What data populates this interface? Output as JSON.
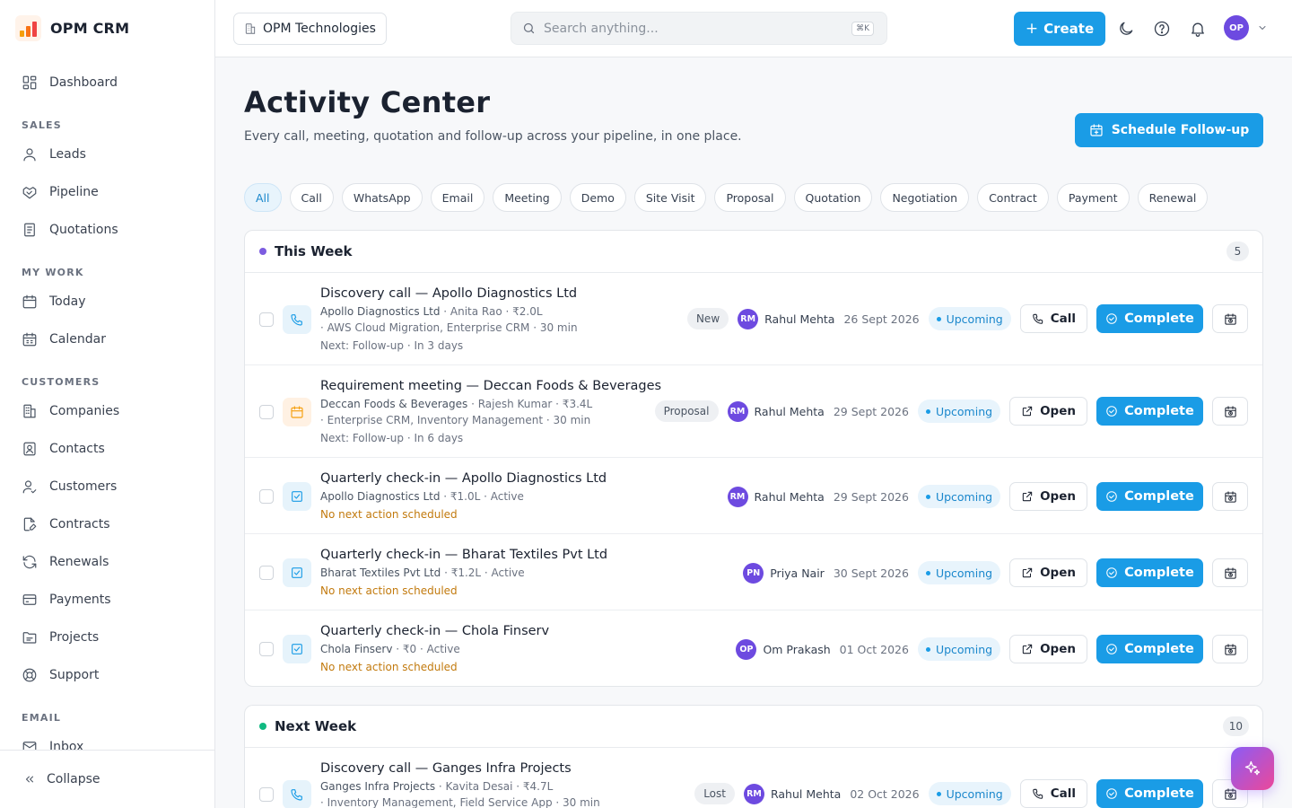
{
  "app": {
    "name": "OPM CRM",
    "logo_colors": [
      "#f59e0b",
      "#f97316",
      "#ef4444"
    ]
  },
  "sidebar": {
    "top": [
      {
        "label": "Dashboard",
        "icon": "dashboard-icon"
      }
    ],
    "sections": [
      {
        "title": "SALES",
        "items": [
          {
            "label": "Leads",
            "icon": "user-icon"
          },
          {
            "label": "Pipeline",
            "icon": "handshake-icon"
          },
          {
            "label": "Quotations",
            "icon": "document-icon"
          }
        ]
      },
      {
        "title": "MY WORK",
        "items": [
          {
            "label": "Today",
            "icon": "calendar-icon"
          },
          {
            "label": "Calendar",
            "icon": "calendar-grid-icon"
          }
        ]
      },
      {
        "title": "CUSTOMERS",
        "items": [
          {
            "label": "Companies",
            "icon": "building-icon"
          },
          {
            "label": "Contacts",
            "icon": "contact-card-icon"
          },
          {
            "label": "Customers",
            "icon": "user-check-icon"
          },
          {
            "label": "Contracts",
            "icon": "file-pen-icon"
          },
          {
            "label": "Renewals",
            "icon": "refresh-icon"
          },
          {
            "label": "Payments",
            "icon": "credit-card-icon"
          },
          {
            "label": "Projects",
            "icon": "folder-icon"
          },
          {
            "label": "Support",
            "icon": "lifebuoy-icon"
          }
        ]
      },
      {
        "title": "EMAIL",
        "items": [
          {
            "label": "Inbox",
            "icon": "mail-icon"
          }
        ]
      }
    ],
    "collapse_label": "Collapse"
  },
  "header": {
    "org": "OPM Technologies",
    "search_placeholder": "Search anything...",
    "search_shortcut": "⌘K",
    "create_label": "Create",
    "avatar": "OP"
  },
  "page": {
    "title": "Activity Center",
    "subtitle": "Every call, meeting, quotation and follow-up across your pipeline, in one place.",
    "schedule_label": "Schedule Follow-up"
  },
  "filters": [
    "All",
    "Call",
    "WhatsApp",
    "Email",
    "Meeting",
    "Demo",
    "Site Visit",
    "Proposal",
    "Quotation",
    "Negotiation",
    "Contract",
    "Payment",
    "Renewal"
  ],
  "active_filter": "All",
  "groups": [
    {
      "title": "This Week",
      "count": "5",
      "dot_color": "#7c5ce0",
      "rows": [
        {
          "type": "call",
          "title": "Discovery call — Apollo Diagnostics Ltd",
          "meta1": "Apollo Diagnostics Ltd",
          "meta1_rest": " · Anita Rao  · ₹2.0L",
          "meta2": " · AWS Cloud Migration, Enterprise CRM  · 30 min",
          "meta3": "Next: Follow-up · In 3 days",
          "stage": "New",
          "owner_initials": "RM",
          "owner": "Rahul Mehta",
          "date": "26 Sept 2026",
          "status": "Upcoming",
          "action": "Call",
          "complete": "Complete"
        },
        {
          "type": "meeting",
          "title": "Requirement meeting — Deccan Foods & Beverages",
          "meta1": "Deccan Foods & Beverages",
          "meta1_rest": " · Rajesh Kumar  · ₹3.4L",
          "meta2": " · Enterprise CRM, Inventory Management  · 30 min",
          "meta3": "Next: Follow-up · In 6 days",
          "stage": "Proposal",
          "owner_initials": "RM",
          "owner": "Rahul Mehta",
          "date": "29 Sept 2026",
          "status": "Upcoming",
          "action": "Open",
          "complete": "Complete"
        },
        {
          "type": "task",
          "title": "Quarterly check-in — Apollo Diagnostics Ltd",
          "meta1": "Apollo Diagnostics Ltd",
          "meta1_rest": " · ₹1.0L  · Active",
          "warn": "No next action scheduled",
          "owner_initials": "RM",
          "owner": "Rahul Mehta",
          "date": "29 Sept 2026",
          "status": "Upcoming",
          "action": "Open",
          "complete": "Complete"
        },
        {
          "type": "task",
          "title": "Quarterly check-in — Bharat Textiles Pvt Ltd",
          "meta1": "Bharat Textiles Pvt Ltd",
          "meta1_rest": " · ₹1.2L  · Active",
          "warn": "No next action scheduled",
          "owner_initials": "PN",
          "owner": "Priya Nair",
          "date": "30 Sept 2026",
          "status": "Upcoming",
          "action": "Open",
          "complete": "Complete"
        },
        {
          "type": "task",
          "title": "Quarterly check-in — Chola Finserv",
          "meta1": "Chola Finserv",
          "meta1_rest": " · ₹0  · Active",
          "warn": "No next action scheduled",
          "owner_initials": "OP",
          "owner": "Om Prakash",
          "date": "01 Oct 2026",
          "status": "Upcoming",
          "action": "Open",
          "complete": "Complete"
        }
      ]
    },
    {
      "title": "Next Week",
      "count": "10",
      "dot_color": "#10b981",
      "rows": [
        {
          "type": "call",
          "title": "Discovery call — Ganges Infra Projects",
          "meta1": "Ganges Infra Projects",
          "meta1_rest": " · Kavita Desai  · ₹4.7L",
          "meta2": " · Inventory Management, Field Service App  · 30 min",
          "stage": "Lost",
          "owner_initials": "RM",
          "owner": "Rahul Mehta",
          "date": "02 Oct 2026",
          "status": "Upcoming",
          "action": "Call",
          "complete": "Complete"
        }
      ]
    }
  ],
  "colors": {
    "accent": "#1a9ce6",
    "brand_purple": "#6d4ae0",
    "warning": "#c27a0e"
  }
}
